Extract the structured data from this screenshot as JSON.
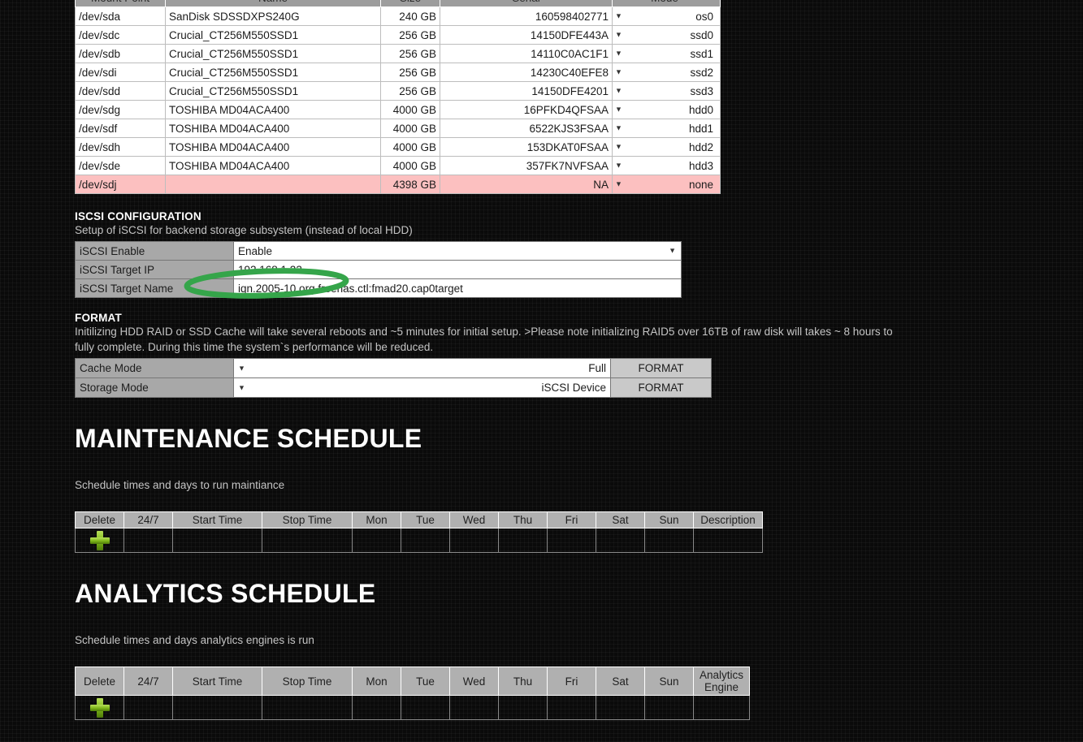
{
  "disk_table": {
    "headers": [
      "Mount Point",
      "Name",
      "Size",
      "Serial",
      "Mode"
    ],
    "rows": [
      {
        "mount": "/dev/sda",
        "name": "SanDisk SDSSDXPS240G",
        "size": "240 GB",
        "serial": "160598402771",
        "mode": "os0",
        "flagged": false
      },
      {
        "mount": "/dev/sdc",
        "name": "Crucial_CT256M550SSD1",
        "size": "256 GB",
        "serial": "14150DFE443A",
        "mode": "ssd0",
        "flagged": false
      },
      {
        "mount": "/dev/sdb",
        "name": "Crucial_CT256M550SSD1",
        "size": "256 GB",
        "serial": "14110C0AC1F1",
        "mode": "ssd1",
        "flagged": false
      },
      {
        "mount": "/dev/sdi",
        "name": "Crucial_CT256M550SSD1",
        "size": "256 GB",
        "serial": "14230C40EFE8",
        "mode": "ssd2",
        "flagged": false
      },
      {
        "mount": "/dev/sdd",
        "name": "Crucial_CT256M550SSD1",
        "size": "256 GB",
        "serial": "14150DFE4201",
        "mode": "ssd3",
        "flagged": false
      },
      {
        "mount": "/dev/sdg",
        "name": "TOSHIBA MD04ACA400",
        "size": "4000 GB",
        "serial": "16PFKD4QFSAA",
        "mode": "hdd0",
        "flagged": false
      },
      {
        "mount": "/dev/sdf",
        "name": "TOSHIBA MD04ACA400",
        "size": "4000 GB",
        "serial": "6522KJS3FSAA",
        "mode": "hdd1",
        "flagged": false
      },
      {
        "mount": "/dev/sdh",
        "name": "TOSHIBA MD04ACA400",
        "size": "4000 GB",
        "serial": "153DKAT0FSAA",
        "mode": "hdd2",
        "flagged": false
      },
      {
        "mount": "/dev/sde",
        "name": "TOSHIBA MD04ACA400",
        "size": "4000 GB",
        "serial": "357FK7NVFSAA",
        "mode": "hdd3",
        "flagged": false
      },
      {
        "mount": "/dev/sdj",
        "name": "",
        "size": "4398 GB",
        "serial": "NA",
        "mode": "none",
        "flagged": true
      }
    ]
  },
  "iscsi": {
    "title": "ISCSI CONFIGURATION",
    "description": "Setup of iSCSI for backend storage subsystem (instead of local HDD)",
    "fields": [
      {
        "label": "iSCSI Enable",
        "value": "Enable",
        "control": "select"
      },
      {
        "label": "iSCSI Target IP",
        "value": "192.168.1.23",
        "control": "text"
      },
      {
        "label": "iSCSI Target Name",
        "value": "iqn.2005-10.org.freenas.ctl:fmad20.cap0target",
        "control": "text"
      }
    ]
  },
  "format": {
    "title": "FORMAT",
    "description": "Initilizing HDD RAID or SSD Cache will take several reboots and ~5 minutes for initial setup. >Please note initializing RAID5 over 16TB of raw disk will takes ~ 8 hours to fully complete. During this time the system`s performance will be reduced.",
    "rows": [
      {
        "label": "Cache Mode",
        "value": "Full",
        "button": "FORMAT"
      },
      {
        "label": "Storage Mode",
        "value": "iSCSI Device",
        "button": "FORMAT"
      }
    ]
  },
  "maintenance": {
    "title": "MAINTENANCE SCHEDULE",
    "description": "Schedule times and days to run maintiance",
    "headers": [
      "Delete",
      "24/7",
      "Start Time",
      "Stop Time",
      "Mon",
      "Tue",
      "Wed",
      "Thu",
      "Fri",
      "Sat",
      "Sun",
      "Description"
    ],
    "rows": [
      {
        "delete": "add",
        "247": "",
        "start": "",
        "stop": "",
        "mon": "",
        "tue": "",
        "wed": "",
        "thu": "",
        "fri": "",
        "sat": "",
        "sun": "",
        "last": ""
      }
    ]
  },
  "analytics": {
    "title": "ANALYTICS SCHEDULE",
    "description": "Schedule times and days analytics engines is run",
    "headers": [
      "Delete",
      "24/7",
      "Start Time",
      "Stop Time",
      "Mon",
      "Tue",
      "Wed",
      "Thu",
      "Fri",
      "Sat",
      "Sun",
      "Analytics Engine"
    ],
    "rows": [
      {
        "delete": "add",
        "247": "",
        "start": "",
        "stop": "",
        "mon": "",
        "tue": "",
        "wed": "",
        "thu": "",
        "fri": "",
        "sat": "",
        "sun": "",
        "last": ""
      }
    ]
  },
  "annotation": {
    "type": "ellipse-highlight",
    "color": "#35a54a",
    "target": "iSCSI Target IP value"
  },
  "icons": {
    "add_row": "plus-icon",
    "dropdown": "chevron-down-icon"
  }
}
